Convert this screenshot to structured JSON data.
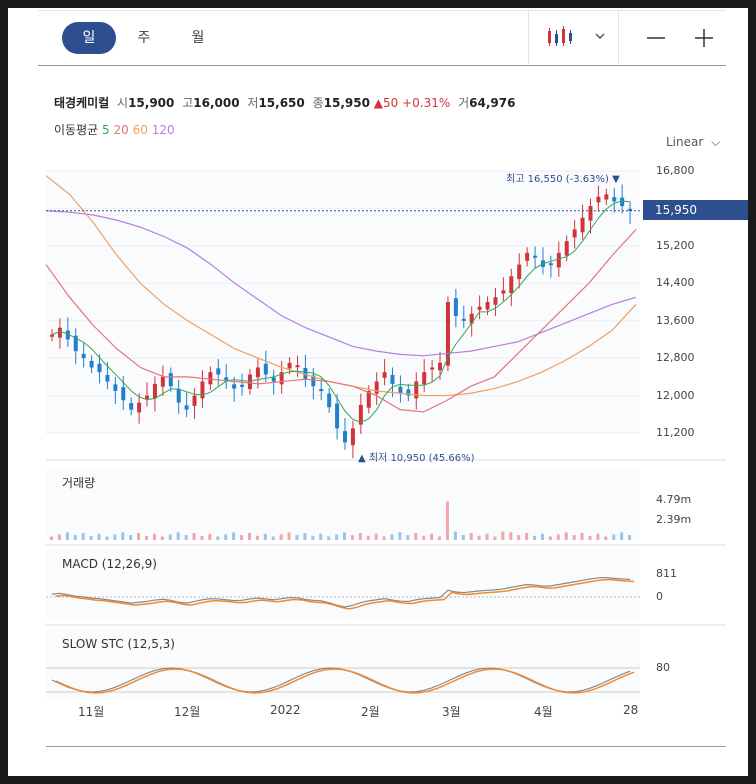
{
  "tabs": [
    "일",
    "주",
    "월"
  ],
  "stock": {
    "name": "태경케미컬",
    "open_label": "시",
    "open": "15,900",
    "high_label": "고",
    "high": "16,000",
    "low_label": "저",
    "low": "15,650",
    "close_label": "종",
    "close": "15,950",
    "change": "▲50",
    "change_pct": "+0.31%",
    "volume_label": "거",
    "volume": "64,976"
  },
  "ma": {
    "label": "이동평균",
    "periods": [
      "5",
      "20",
      "60",
      "120"
    ],
    "colors": [
      "#34a853",
      "#e8737a",
      "#f0a060",
      "#b67ee0"
    ]
  },
  "scale_mode": "Linear",
  "colors": {
    "up": "#d0343b",
    "down": "#1f7fd0",
    "accent": "#2e4f8f"
  },
  "price_axis": {
    "ticks": [
      "16,800",
      "15,200",
      "14,400",
      "13,600",
      "12,800",
      "12,000",
      "11,200"
    ],
    "current": "15,950"
  },
  "annotations": {
    "high": "최고 16,550 (-3.63%) ▼",
    "low": "▲ 최저 10,950 (45.66%)"
  },
  "volume_pane": {
    "label": "거래량",
    "ticks": [
      "4.79m",
      "2.39m"
    ]
  },
  "macd_pane": {
    "label": "MACD (12,26,9)",
    "ticks": [
      "811",
      "0"
    ]
  },
  "stoch_pane": {
    "label": "SLOW STC (12,5,3)",
    "ticks": [
      "80"
    ]
  },
  "x_axis": [
    "11월",
    "12월",
    "2022",
    "2월",
    "3월",
    "4월",
    "28"
  ],
  "chart_data": {
    "type": "candlestick",
    "ylim": [
      10800,
      16900
    ],
    "close_path": [
      13300,
      13450,
      13200,
      12950,
      12800,
      12600,
      12500,
      12300,
      12100,
      11900,
      11700,
      11850,
      12000,
      12250,
      12400,
      12200,
      11850,
      11700,
      12000,
      12300,
      12500,
      12450,
      12300,
      12150,
      12200,
      12450,
      12600,
      12450,
      12300,
      12500,
      12700,
      12650,
      12350,
      12200,
      12100,
      11750,
      11300,
      11000,
      11300,
      11800,
      12100,
      12300,
      12500,
      12250,
      12050,
      12000,
      12300,
      12500,
      12600,
      12700,
      14000,
      13700,
      13600,
      13750,
      13900,
      14000,
      14100,
      14250,
      14550,
      14800,
      15050,
      14950,
      14750,
      14800,
      15050,
      15300,
      15550,
      15800,
      16050,
      16250,
      16300,
      16150,
      16050,
      15950
    ],
    "ma_series": [
      {
        "name": "120",
        "values": [
          15950,
          15920,
          15860,
          15750,
          15600,
          15400,
          15150,
          14800,
          14400,
          14050,
          13700,
          13450,
          13250,
          13050,
          12950,
          12880,
          12850,
          12900,
          12950,
          13050,
          13150,
          13350,
          13550,
          13750,
          13950,
          14100
        ]
      },
      {
        "name": "60",
        "values": [
          16700,
          16300,
          15700,
          15000,
          14400,
          13950,
          13600,
          13300,
          13000,
          12800,
          12600,
          12450,
          12300,
          12200,
          12100,
          12050,
          12000,
          12000,
          12050,
          12150,
          12300,
          12500,
          12750,
          13050,
          13400,
          13950
        ]
      },
      {
        "name": "20",
        "values": [
          14800,
          14100,
          13500,
          13000,
          12600,
          12400,
          12400,
          12350,
          12300,
          12250,
          12300,
          12350,
          12300,
          12200,
          12000,
          11700,
          11650,
          11900,
          12200,
          12400,
          12900,
          13400,
          13900,
          14400,
          15000,
          15550
        ]
      }
    ]
  }
}
